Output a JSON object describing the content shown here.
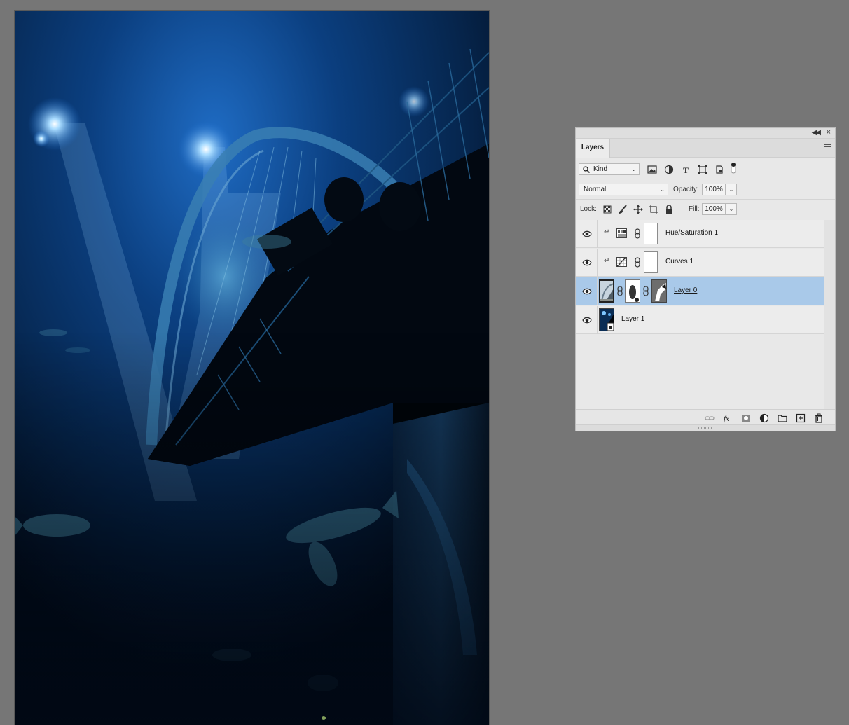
{
  "canvas": {
    "description_icon": "underwater-aquarium-photo"
  },
  "panel": {
    "tab_label": "Layers",
    "filter": {
      "kind_label": "Kind"
    },
    "blend_mode": "Normal",
    "opacity_label": "Opacity:",
    "opacity_value": "100%",
    "lock_label": "Lock:",
    "fill_label": "Fill:",
    "fill_value": "100%",
    "layers": [
      {
        "name": "Hue/Saturation 1",
        "type": "adjustment",
        "adjustment": "hue-saturation",
        "clipped": true,
        "visible": true,
        "selected": false
      },
      {
        "name": "Curves 1",
        "type": "adjustment",
        "adjustment": "curves",
        "clipped": true,
        "visible": true,
        "selected": false
      },
      {
        "name": "Layer 0",
        "type": "pixel",
        "has_mask": true,
        "has_smart_filter": true,
        "visible": true,
        "selected": true
      },
      {
        "name": "Layer 1",
        "type": "smart-object",
        "visible": true,
        "selected": false
      }
    ]
  },
  "colors": {
    "selected_row": "#a9c9e9",
    "panel_bg": "#e8e8e8",
    "workspace_bg": "#767676"
  }
}
